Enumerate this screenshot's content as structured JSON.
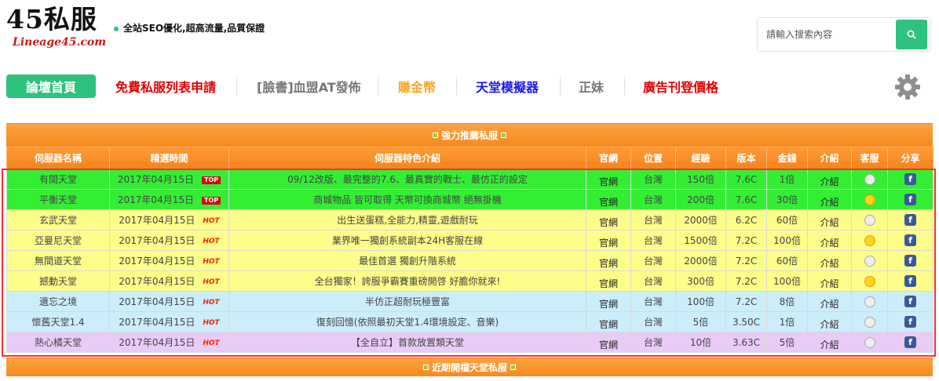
{
  "header": {
    "logo_main": "45私服",
    "logo_sub": "Lineage45.com",
    "slogan": "全站SEO優化,超高流量,品質保證",
    "search_placeholder": "請輸入搜索內容",
    "search_icon": "search-icon"
  },
  "nav": {
    "items": [
      {
        "label": "論壇首頁",
        "color": "#ffffff"
      },
      {
        "label": "免費私服列表申請",
        "color": "#e10000"
      },
      {
        "label": "[臉書]血盟AT發佈",
        "color": "#777777"
      },
      {
        "label": "賺金幣",
        "color": "#f5a623"
      },
      {
        "label": "天堂模擬器",
        "color": "#1a1ae6"
      },
      {
        "label": "正妹",
        "color": "#777777"
      },
      {
        "label": "廣告刊登價格",
        "color": "#e10000"
      }
    ],
    "settings_icon": "gear-icon"
  },
  "table": {
    "section_title": "強力推薦私服",
    "next_section_title": "近期開檔天堂私服",
    "columns": [
      "伺服器名稱",
      "精選時間",
      "伺服器特色介紹",
      "官網",
      "位置",
      "經驗",
      "版本",
      "金錢",
      "介紹",
      "客服",
      "分享"
    ],
    "rows": [
      {
        "color": "green",
        "name": "有間天堂",
        "time": "2017年04月15日",
        "badge": "TOP",
        "desc": "09/12改版、最完整的7.6、最真實的戰士、最仿正的設定",
        "site": "官網",
        "loc": "台灣",
        "exp": "150倍",
        "ver": "7.6C",
        "money": "1倍",
        "intro": "介紹",
        "cs": "off",
        "share": "f"
      },
      {
        "color": "green",
        "name": "平衡天堂",
        "time": "2017年04月15日",
        "badge": "TOP",
        "desc": "商城物品 皆可取得 天幣可換商城幣 絕無掛機",
        "site": "官網",
        "loc": "台灣",
        "exp": "200倍",
        "ver": "7.6C",
        "money": "30倍",
        "intro": "介紹",
        "cs": "happy",
        "share": "f"
      },
      {
        "color": "yellow",
        "name": "玄武天堂",
        "time": "2017年04月15日",
        "badge": "HOT",
        "desc": "出生送蛋糕,全能力,精靈,遊戲耐玩",
        "site": "官網",
        "loc": "台灣",
        "exp": "2000倍",
        "ver": "6.2C",
        "money": "60倍",
        "intro": "介紹",
        "cs": "off",
        "share": "f"
      },
      {
        "color": "yellow",
        "name": "亞曼尼天堂",
        "time": "2017年04月15日",
        "badge": "HOT",
        "desc": "業界唯一獨創系統副本24H客服在線",
        "site": "官網",
        "loc": "台灣",
        "exp": "1500倍",
        "ver": "7.2C",
        "money": "100倍",
        "intro": "介紹",
        "cs": "happy",
        "share": "f"
      },
      {
        "color": "yellow",
        "name": "無間道天堂",
        "time": "2017年04月15日",
        "badge": "HOT",
        "desc": "最佳首選 獨創升階系統",
        "site": "官網",
        "loc": "台灣",
        "exp": "2000倍",
        "ver": "7.2C",
        "money": "60倍",
        "intro": "介紹",
        "cs": "off",
        "share": "f"
      },
      {
        "color": "yellow",
        "name": "撼動天堂",
        "time": "2017年04月15日",
        "badge": "HOT",
        "desc": "全台獨家！誇服爭霸賽重磅開啓 好膽你就來!",
        "site": "官網",
        "loc": "台灣",
        "exp": "300倍",
        "ver": "7.2C",
        "money": "100倍",
        "intro": "介紹",
        "cs": "happy",
        "share": "f"
      },
      {
        "color": "blue",
        "name": "遺忘之境",
        "time": "2017年04月15日",
        "badge": "HOT",
        "desc": "半仿正超耐玩極豐富",
        "site": "官網",
        "loc": "台灣",
        "exp": "100倍",
        "ver": "7.2C",
        "money": "8倍",
        "intro": "介紹",
        "cs": "off",
        "share": "f"
      },
      {
        "color": "blue",
        "name": "懷舊天堂1.4",
        "time": "2017年04月15日",
        "badge": "HOT",
        "desc": "復刻回憶(依照最初天堂1.4環境設定、音樂)",
        "site": "官網",
        "loc": "台灣",
        "exp": "5倍",
        "ver": "3.50C",
        "money": "1倍",
        "intro": "介紹",
        "cs": "off",
        "share": "f"
      },
      {
        "color": "purple",
        "name": "熱心橘天堂",
        "time": "2017年04月15日",
        "badge": "HOT",
        "desc": "【全自立】首款放置類天堂",
        "site": "官網",
        "loc": "台灣",
        "exp": "10倍",
        "ver": "3.63C",
        "money": "5倍",
        "intro": "介紹",
        "cs": "off",
        "share": "f"
      }
    ]
  }
}
